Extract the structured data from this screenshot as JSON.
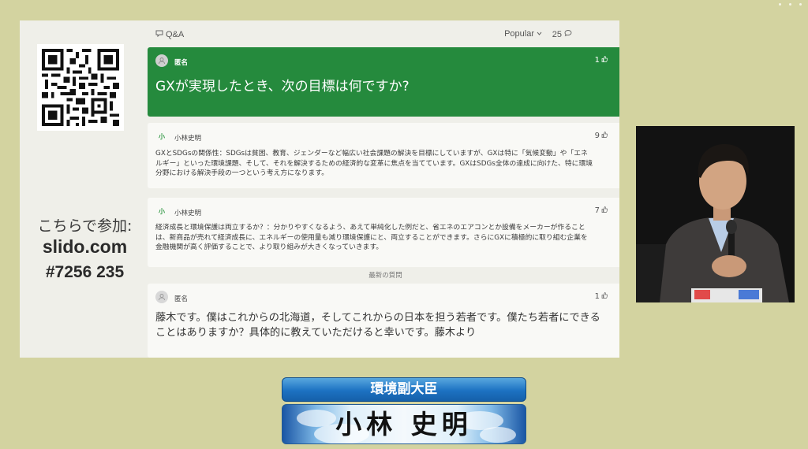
{
  "slido": {
    "join": {
      "label": "こちらで参加:",
      "url": "slido.com",
      "code": "#7256 235"
    },
    "header": {
      "tab_label": "Q&A",
      "tab_icon": "qa-icon",
      "sort_label": "Popular",
      "sort_icon": "chevron-down-icon",
      "count": "25",
      "count_icon": "comment-icon"
    },
    "featured": {
      "author": "匿名",
      "votes": "1",
      "question": "GXが実現したとき、次の目標は何ですか?"
    },
    "answers": [
      {
        "avatar_letter": "小",
        "author": "小林史明",
        "votes": "9",
        "text": "GXとSDGsの関係性：SDGsは貧困、教育、ジェンダーなど幅広い社会課題の解決を目標にしていますが、GXは特に「気候変動」や「エネルギー」といった環境課題、そして、それを解決するための経済的な変革に焦点を当てています。GXはSDGs全体の達成に向けた、特に環境分野における解決手段の一つという考え方になります。"
      },
      {
        "avatar_letter": "小",
        "author": "小林史明",
        "votes": "7",
        "text": "経済成長と環境保護は両立するか？：分かりやすくなるよう、あえて単純化した例だと、省エネのエアコンとか設備をメーカーが作ることは、新商品が売れて経済成長に、エネルギーの使用量も減り環境保護にと、両立することができます。さらにGXに積極的に取り組む企業を金融機関が高く評価することで、より取り組みが大きくなっていきます。"
      }
    ],
    "recent_label": "最新の質問",
    "recent": {
      "author": "匿名",
      "votes": "1",
      "text": "藤木です。僕はこれからの北海道，そしてこれからの日本を担う若者です。僕たち若者にできることはありますか？具体的に教えていただけると幸いです。藤木より"
    }
  },
  "caption": {
    "title": "環境副大臣",
    "name": "小林 史明"
  },
  "colors": {
    "background": "#d3d3a0",
    "featured": "#258a3d",
    "caption_blue": "#1d72c2"
  }
}
